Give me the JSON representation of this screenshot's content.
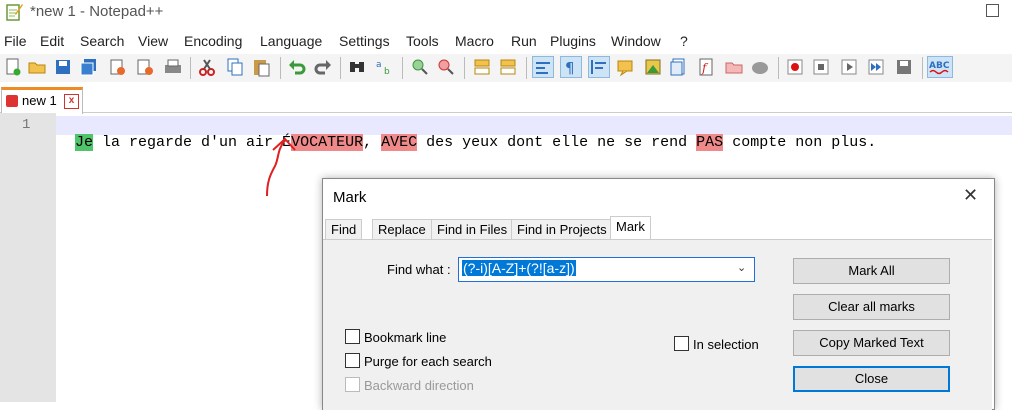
{
  "window": {
    "title": "*new 1 - Notepad++"
  },
  "menu": [
    "File",
    "Edit",
    "Search",
    "View",
    "Encoding",
    "Language",
    "Settings",
    "Tools",
    "Macro",
    "Run",
    "Plugins",
    "Window",
    "?"
  ],
  "tab": {
    "label": "new 1",
    "close": "x"
  },
  "editor": {
    "line_number": "1",
    "segments": [
      {
        "text": "Je",
        "hl": "green"
      },
      {
        "text": " la regarde d'un air É",
        "hl": ""
      },
      {
        "text": "VOCATEUR",
        "hl": "red"
      },
      {
        "text": ", ",
        "hl": ""
      },
      {
        "text": "AVEC",
        "hl": "red"
      },
      {
        "text": " des yeux dont elle ne se rend ",
        "hl": ""
      },
      {
        "text": "PAS",
        "hl": "red"
      },
      {
        "text": " compte non plus.",
        "hl": ""
      }
    ]
  },
  "dialog": {
    "title": "Mark",
    "close": "✕",
    "tabs": [
      "Find",
      "Replace",
      "Find in Files",
      "Find in Projects",
      "Mark"
    ],
    "find_what_label": "Find what :",
    "find_what_value": "(?-i)[A-Z]+(?![a-z])",
    "buttons": {
      "mark_all": "Mark All",
      "clear_all": "Clear all marks",
      "copy_marked": "Copy Marked Text",
      "close": "Close"
    },
    "options": {
      "bookmark_line": "Bookmark line",
      "purge": "Purge for each search",
      "backward": "Backward direction",
      "in_selection": "In selection"
    }
  },
  "colors": {
    "mark_red": "#f08a8a",
    "mark_green": "#4fc46a",
    "accent": "#0078d7"
  }
}
